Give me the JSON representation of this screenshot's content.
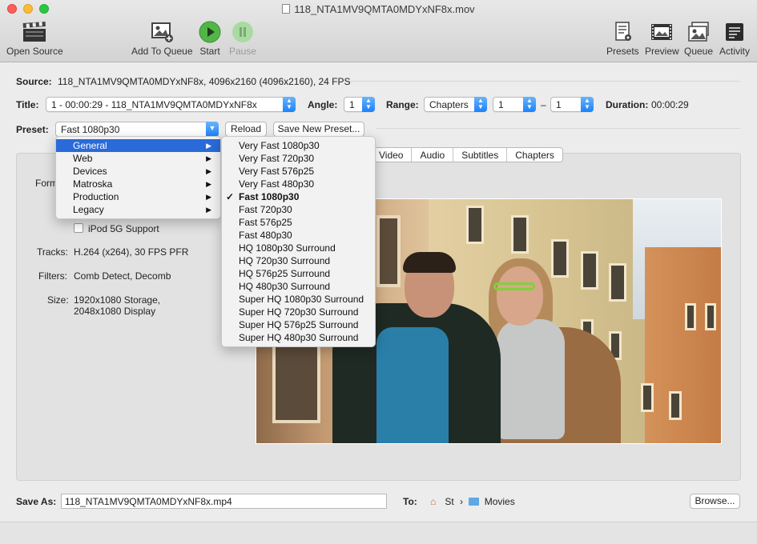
{
  "window": {
    "title": "118_NTA1MV9QMTA0MDYxNF8x.mov"
  },
  "toolbar": {
    "open_source": "Open Source",
    "add_to_queue": "Add To Queue",
    "start": "Start",
    "pause": "Pause",
    "presets": "Presets",
    "preview": "Preview",
    "queue": "Queue",
    "activity": "Activity"
  },
  "source": {
    "label": "Source:",
    "value": "118_NTA1MV9QMTA0MDYxNF8x, 4096x2160 (4096x2160), 24 FPS"
  },
  "title_row": {
    "label": "Title:",
    "value": "1 - 00:00:29 - 118_NTA1MV9QMTA0MDYxNF8x",
    "angle_label": "Angle:",
    "angle_value": "1",
    "range_label": "Range:",
    "range_mode": "Chapters",
    "range_start": "1",
    "range_dash": "–",
    "range_end": "1",
    "duration_label": "Duration:",
    "duration_value": "00:00:29"
  },
  "preset_row": {
    "label": "Preset:",
    "value": "Fast 1080p30",
    "reload": "Reload",
    "save_new": "Save New Preset..."
  },
  "tabs": [
    "Video",
    "Audio",
    "Subtitles",
    "Chapters"
  ],
  "summary": {
    "format_label": "Form",
    "ipod_label": "iPod 5G Support",
    "tracks_label": "Tracks:",
    "tracks_value": "H.264 (x264), 30 FPS PFR",
    "filters_label": "Filters:",
    "filters_value": "Comb Detect, Decomb",
    "size_label": "Size:",
    "size_line1": "1920x1080 Storage,",
    "size_line2": "2048x1080 Display"
  },
  "preset_categories": [
    "General",
    "Web",
    "Devices",
    "Matroska",
    "Production",
    "Legacy"
  ],
  "preset_submenu": [
    "Very Fast 1080p30",
    "Very Fast 720p30",
    "Very Fast 576p25",
    "Very Fast 480p30",
    "Fast 1080p30",
    "Fast 720p30",
    "Fast 576p25",
    "Fast 480p30",
    "HQ 1080p30 Surround",
    "HQ 720p30 Surround",
    "HQ 576p25 Surround",
    "HQ 480p30 Surround",
    "Super HQ 1080p30 Surround",
    "Super HQ 720p30 Surround",
    "Super HQ 576p25 Surround",
    "Super HQ 480p30 Surround"
  ],
  "save": {
    "label": "Save As:",
    "filename": "118_NTA1MV9QMTA0MDYxNF8x.mp4",
    "to_label": "To:",
    "path_home": "St",
    "path_sep": "›",
    "path_folder": "Movies",
    "browse": "Browse..."
  },
  "colors": {
    "accent": "#2a6ad9",
    "popup_arrow": "#1a82fb"
  }
}
